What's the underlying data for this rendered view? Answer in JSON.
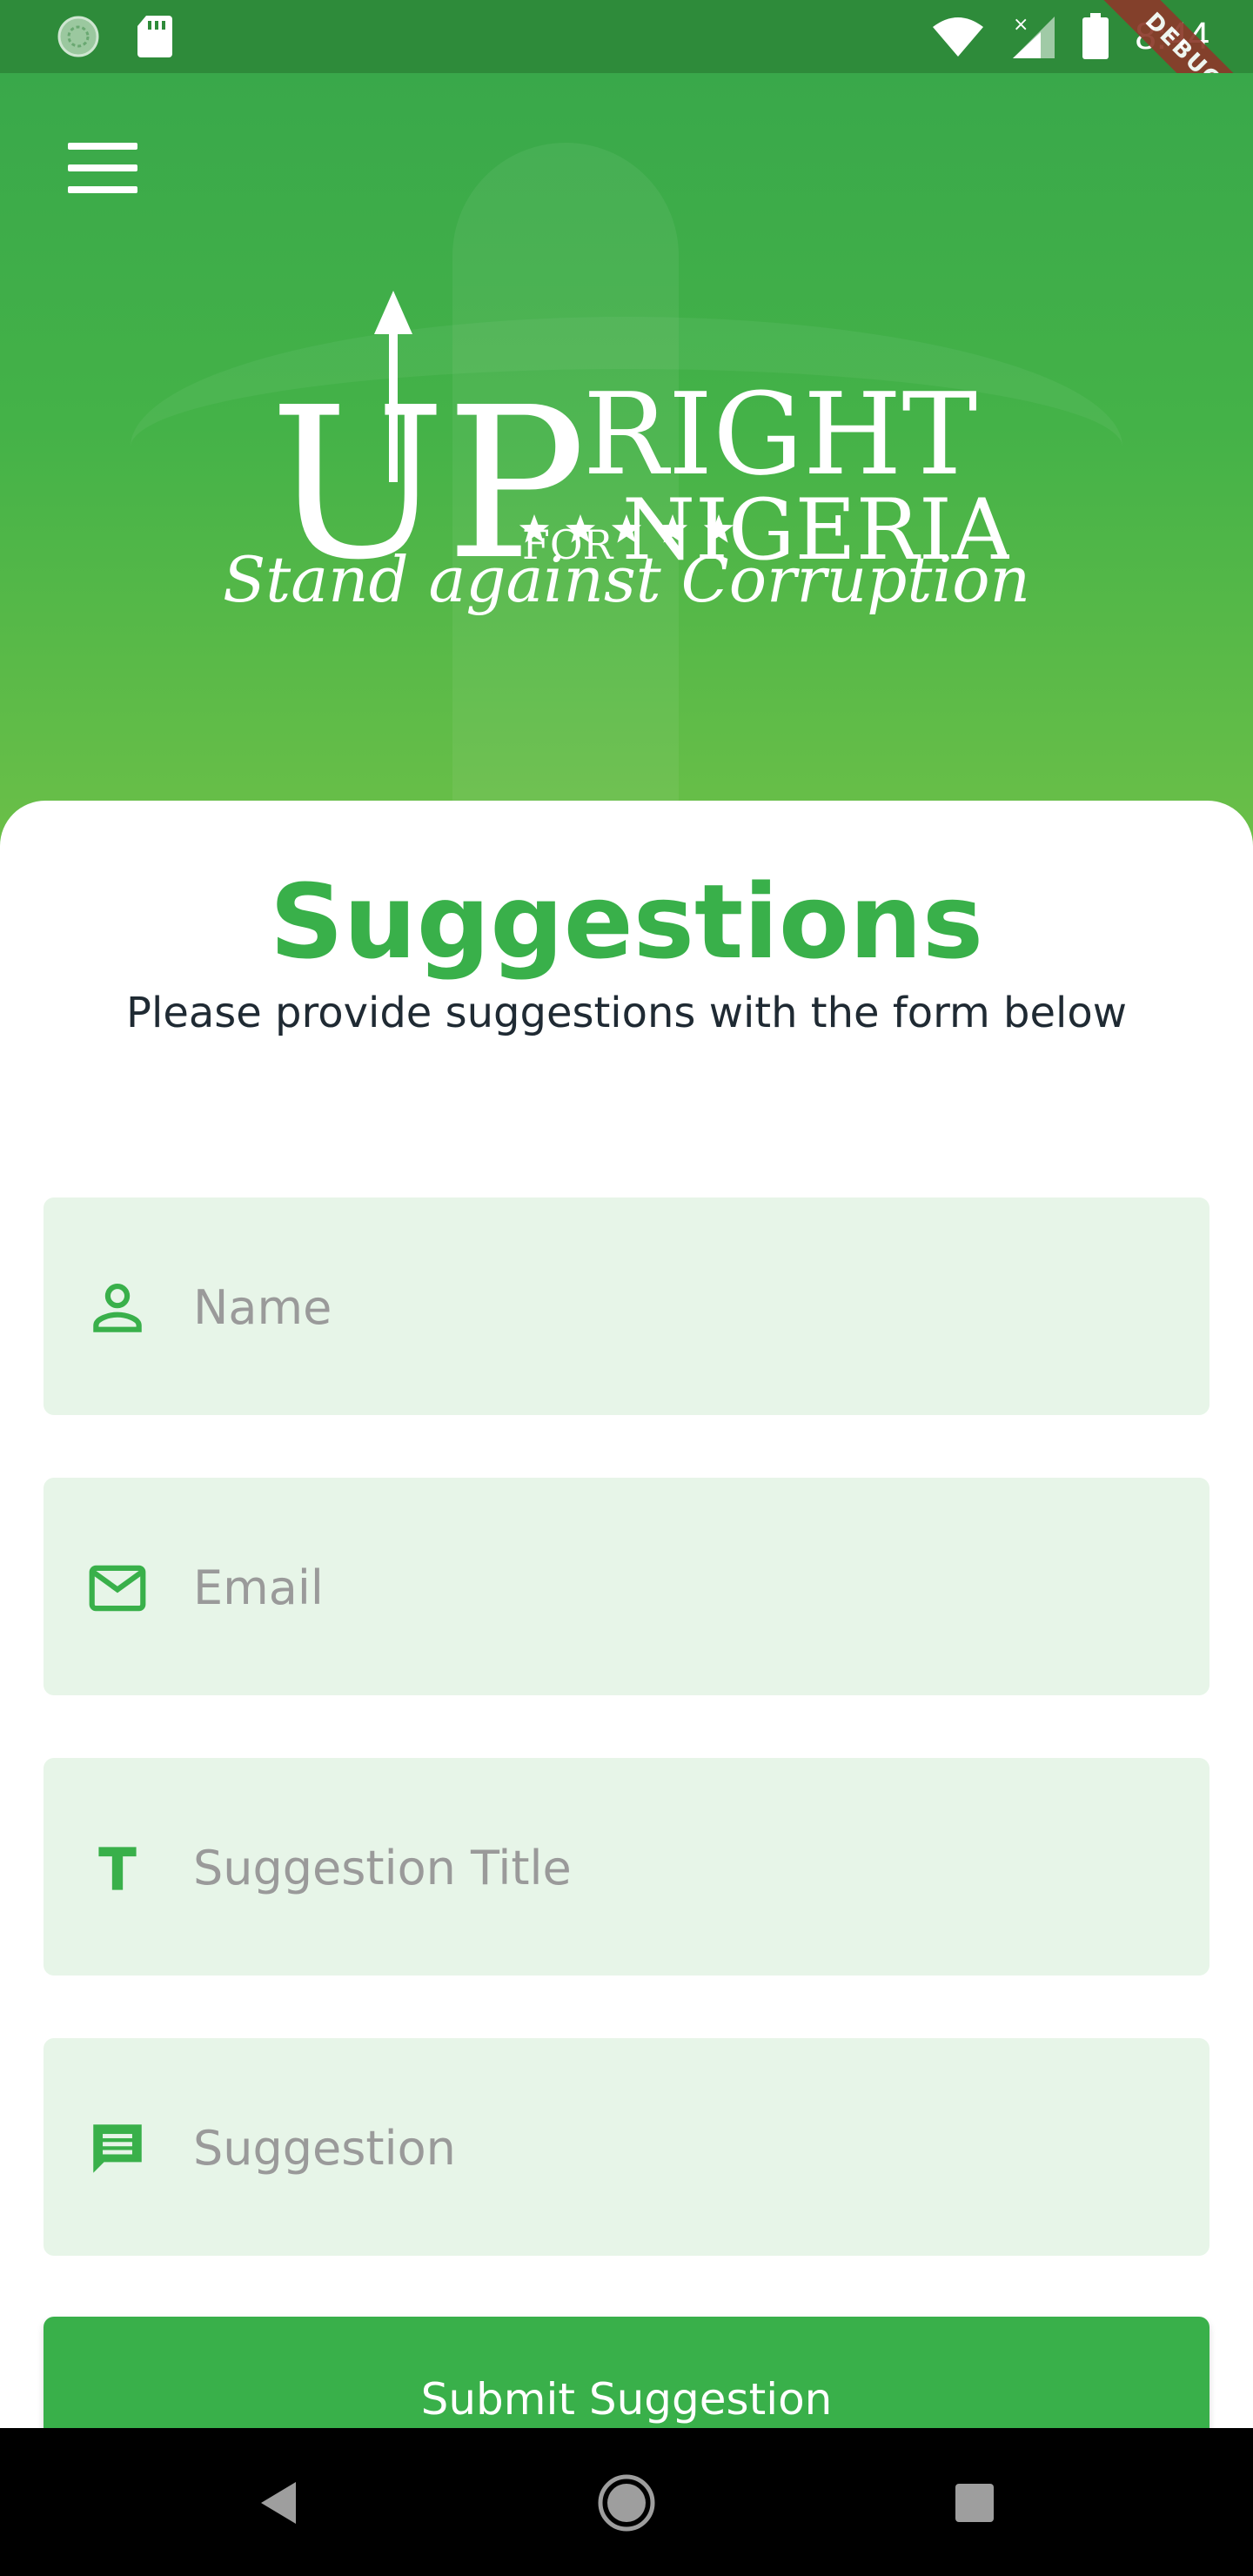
{
  "status_bar": {
    "time": "8:44",
    "left_icons": [
      "sync-icon",
      "sd-card-icon"
    ],
    "right_icons": [
      "wifi-icon",
      "cell-signal-icon",
      "battery-icon"
    ],
    "debug_banner": "DEBUG"
  },
  "hero": {
    "logo": {
      "big_letters": "UP",
      "word_right": "RIGHT",
      "word_for": "FOR",
      "word_nigeria": "NIGERIA",
      "stars": 5
    },
    "tagline": "Stand against Corruption"
  },
  "form": {
    "title": "Suggestions",
    "subtitle": "Please provide suggestions with the form below",
    "fields": [
      {
        "placeholder": "Name",
        "icon": "person-icon"
      },
      {
        "placeholder": "Email",
        "icon": "mail-icon"
      },
      {
        "placeholder": "Suggestion Title",
        "icon": "text-title-icon"
      },
      {
        "placeholder": "Suggestion",
        "icon": "message-icon"
      }
    ],
    "submit_label": "Submit Suggestion"
  },
  "colors": {
    "primary_green": "#39b04a",
    "field_background": "#e7f5e8",
    "status_bar": "#2e8b3a",
    "text_dark": "#1f2a33"
  },
  "nav_bar": {
    "buttons": [
      "back-icon",
      "home-icon",
      "recents-icon"
    ]
  }
}
